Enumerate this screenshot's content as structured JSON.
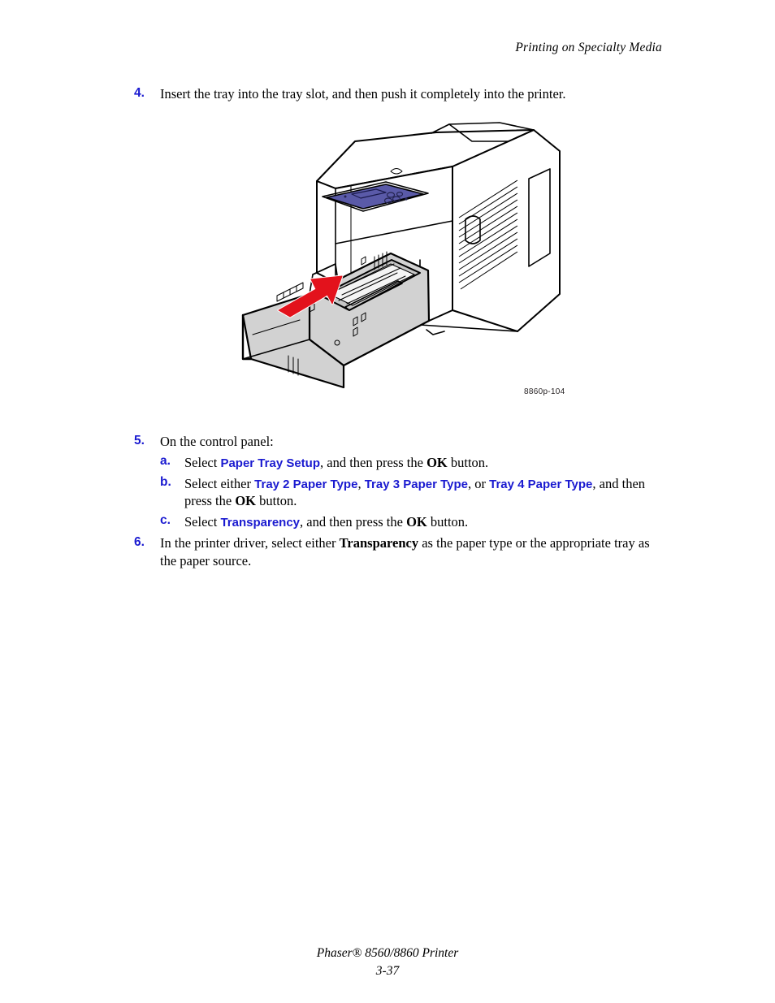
{
  "header": {
    "running_head": "Printing on Specialty Media"
  },
  "steps": [
    {
      "number": "4.",
      "text": "Insert the tray into the tray slot, and then push it completely into the printer."
    },
    {
      "number": "5.",
      "text": "On the control panel:"
    },
    {
      "number": "6.",
      "text_before": "In the printer driver, select either ",
      "bold_term": "Transparency",
      "text_after": " as the paper type or the appropriate tray as the paper source."
    }
  ],
  "substeps": [
    {
      "letter": "a.",
      "lead": "Select ",
      "ui_term_1": "Paper Tray Setup",
      "mid_1": ", and then press the ",
      "ok_label": "OK",
      "tail": " button."
    },
    {
      "letter": "b.",
      "lead": "Select either ",
      "ui_term_1": "Tray 2 Paper Type",
      "sep_1": ", ",
      "ui_term_2": "Tray 3 Paper Type",
      "sep_2": ", or ",
      "ui_term_3": "Tray 4 Paper Type",
      "mid_1": ", and then press the ",
      "ok_label": "OK",
      "tail": " button."
    },
    {
      "letter": "c.",
      "lead": "Select ",
      "ui_term_1": "Transparency",
      "mid_1": ", and then press the ",
      "ok_label": "OK",
      "tail": " button."
    }
  ],
  "figure": {
    "id_label": "8860p-104",
    "alt": "Line drawing of Phaser printer with paper tray pulled out and a red arrow showing the tray being pushed into the printer",
    "colors": {
      "outline": "#000000",
      "body_fill": "#ffffff",
      "tray_fill": "#d2d2d2",
      "tray_shade": "#bfbfbf",
      "paper_fill": "#f2f2f2",
      "control_panel": "#5a5aa8",
      "arrow_red": "#e3121c"
    }
  },
  "footer": {
    "product": "Phaser® 8560/8860 Printer",
    "page_number": "3-37"
  },
  "theme": {
    "link_blue": "#1a1ad0",
    "text_black": "#000000",
    "page_background": "#ffffff"
  }
}
